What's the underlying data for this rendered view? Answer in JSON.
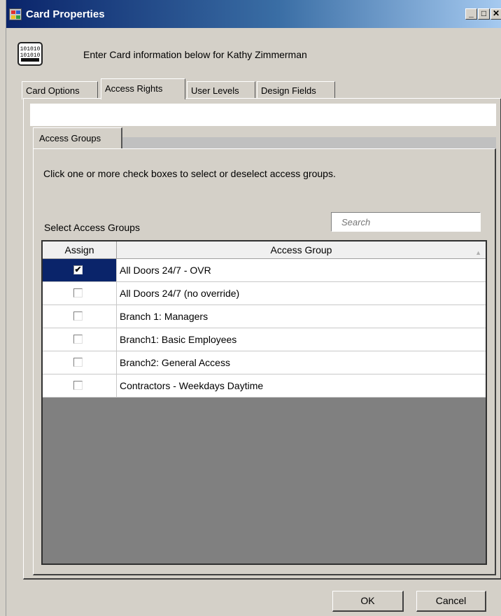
{
  "window": {
    "title": "Card Properties",
    "controls": {
      "minimize": "_",
      "maximize": "□",
      "close": "✕"
    }
  },
  "header": {
    "icon_text_line1": "101010",
    "icon_text_line2": "101010",
    "text": "Enter Card information below for Kathy Zimmerman"
  },
  "tabs": [
    {
      "label": "Card Options",
      "active": false
    },
    {
      "label": "Access Rights",
      "active": true
    },
    {
      "label": "User Levels",
      "active": false
    },
    {
      "label": "Design Fields",
      "active": false
    }
  ],
  "inner_tab": {
    "label": "Access Groups"
  },
  "instructions": "Click one or more check boxes to select or deselect access groups.",
  "select_label": "Select Access Groups",
  "search": {
    "placeholder": "Search",
    "value": ""
  },
  "grid": {
    "columns": [
      "Assign",
      "Access Group"
    ],
    "sort_icon": "sort-ascending-icon",
    "rows": [
      {
        "assigned": true,
        "group": "All Doors 24/7 - OVR"
      },
      {
        "assigned": false,
        "group": "All Doors 24/7 (no override)"
      },
      {
        "assigned": false,
        "group": "Branch 1: Managers"
      },
      {
        "assigned": false,
        "group": "Branch1: Basic Employees"
      },
      {
        "assigned": false,
        "group": "Branch2: General Access"
      },
      {
        "assigned": false,
        "group": "Contractors - Weekdays Daytime"
      }
    ]
  },
  "buttons": {
    "ok": "OK",
    "cancel": "Cancel"
  },
  "colors": {
    "selection": "#0a246a",
    "titlebar_start": "#0a246a",
    "titlebar_end": "#a6caf0",
    "grid_empty": "#808080"
  }
}
